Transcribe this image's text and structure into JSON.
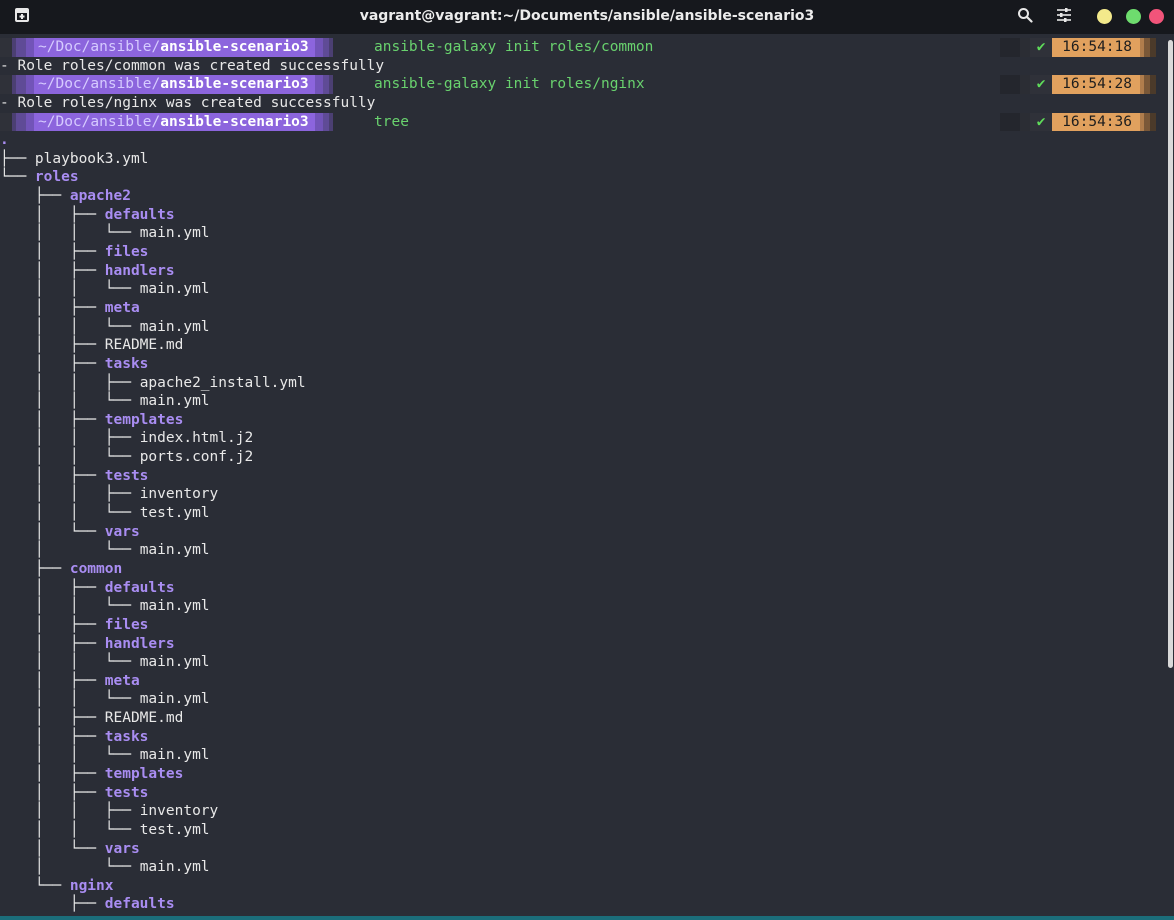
{
  "window": {
    "title": "vagrant@vagrant:~/Documents/ansible/ansible-scenario3"
  },
  "colors": {
    "titlebar_bg": "#16181d",
    "terminal_bg": "#2a2d36",
    "path_segment": "#8c65dd",
    "directory": "#a98df2",
    "command": "#69d26e",
    "time_segment": "#e1a15e",
    "minimize": "#f3e98b",
    "maximize": "#6edc6e",
    "close": "#f2547a"
  },
  "icons": {
    "new_tab": "new-tab-icon",
    "search": "search-icon",
    "menu": "sliders-menu-icon"
  },
  "prompts": [
    {
      "path_dim": "~/Doc",
      "path_mid": "/ansible/",
      "path_bold": "ansible-scenario3",
      "command": "ansible-galaxy init roles/common",
      "status": "✔",
      "time": "16:54:18"
    },
    {
      "path_dim": "~/Doc",
      "path_mid": "/ansible/",
      "path_bold": "ansible-scenario3",
      "command": "ansible-galaxy init roles/nginx",
      "status": "✔",
      "time": "16:54:28"
    },
    {
      "path_dim": "~/Doc",
      "path_mid": "/ansible/",
      "path_bold": "ansible-scenario3",
      "command": "tree",
      "status": "✔",
      "time": "16:54:36"
    }
  ],
  "outputs": [
    "- Role roles/common was created successfully",
    "- Role roles/nginx was created successfully"
  ],
  "tree": [
    {
      "prefix": "",
      "name": ".",
      "dir": true
    },
    {
      "prefix": "├── ",
      "name": "playbook3.yml",
      "dir": false
    },
    {
      "prefix": "└── ",
      "name": "roles",
      "dir": true
    },
    {
      "prefix": "    ├── ",
      "name": "apache2",
      "dir": true
    },
    {
      "prefix": "    │   ├── ",
      "name": "defaults",
      "dir": true
    },
    {
      "prefix": "    │   │   └── ",
      "name": "main.yml",
      "dir": false
    },
    {
      "prefix": "    │   ├── ",
      "name": "files",
      "dir": true
    },
    {
      "prefix": "    │   ├── ",
      "name": "handlers",
      "dir": true
    },
    {
      "prefix": "    │   │   └── ",
      "name": "main.yml",
      "dir": false
    },
    {
      "prefix": "    │   ├── ",
      "name": "meta",
      "dir": true
    },
    {
      "prefix": "    │   │   └── ",
      "name": "main.yml",
      "dir": false
    },
    {
      "prefix": "    │   ├── ",
      "name": "README.md",
      "dir": false
    },
    {
      "prefix": "    │   ├── ",
      "name": "tasks",
      "dir": true
    },
    {
      "prefix": "    │   │   ├── ",
      "name": "apache2_install.yml",
      "dir": false
    },
    {
      "prefix": "    │   │   └── ",
      "name": "main.yml",
      "dir": false
    },
    {
      "prefix": "    │   ├── ",
      "name": "templates",
      "dir": true
    },
    {
      "prefix": "    │   │   ├── ",
      "name": "index.html.j2",
      "dir": false
    },
    {
      "prefix": "    │   │   └── ",
      "name": "ports.conf.j2",
      "dir": false
    },
    {
      "prefix": "    │   ├── ",
      "name": "tests",
      "dir": true
    },
    {
      "prefix": "    │   │   ├── ",
      "name": "inventory",
      "dir": false
    },
    {
      "prefix": "    │   │   └── ",
      "name": "test.yml",
      "dir": false
    },
    {
      "prefix": "    │   └── ",
      "name": "vars",
      "dir": true
    },
    {
      "prefix": "    │       └── ",
      "name": "main.yml",
      "dir": false
    },
    {
      "prefix": "    ├── ",
      "name": "common",
      "dir": true
    },
    {
      "prefix": "    │   ├── ",
      "name": "defaults",
      "dir": true
    },
    {
      "prefix": "    │   │   └── ",
      "name": "main.yml",
      "dir": false
    },
    {
      "prefix": "    │   ├── ",
      "name": "files",
      "dir": true
    },
    {
      "prefix": "    │   ├── ",
      "name": "handlers",
      "dir": true
    },
    {
      "prefix": "    │   │   └── ",
      "name": "main.yml",
      "dir": false
    },
    {
      "prefix": "    │   ├── ",
      "name": "meta",
      "dir": true
    },
    {
      "prefix": "    │   │   └── ",
      "name": "main.yml",
      "dir": false
    },
    {
      "prefix": "    │   ├── ",
      "name": "README.md",
      "dir": false
    },
    {
      "prefix": "    │   ├── ",
      "name": "tasks",
      "dir": true
    },
    {
      "prefix": "    │   │   └── ",
      "name": "main.yml",
      "dir": false
    },
    {
      "prefix": "    │   ├── ",
      "name": "templates",
      "dir": true
    },
    {
      "prefix": "    │   ├── ",
      "name": "tests",
      "dir": true
    },
    {
      "prefix": "    │   │   ├── ",
      "name": "inventory",
      "dir": false
    },
    {
      "prefix": "    │   │   └── ",
      "name": "test.yml",
      "dir": false
    },
    {
      "prefix": "    │   └── ",
      "name": "vars",
      "dir": true
    },
    {
      "prefix": "    │       └── ",
      "name": "main.yml",
      "dir": false
    },
    {
      "prefix": "    └── ",
      "name": "nginx",
      "dir": true
    },
    {
      "prefix": "        ├── ",
      "name": "defaults",
      "dir": true
    }
  ]
}
